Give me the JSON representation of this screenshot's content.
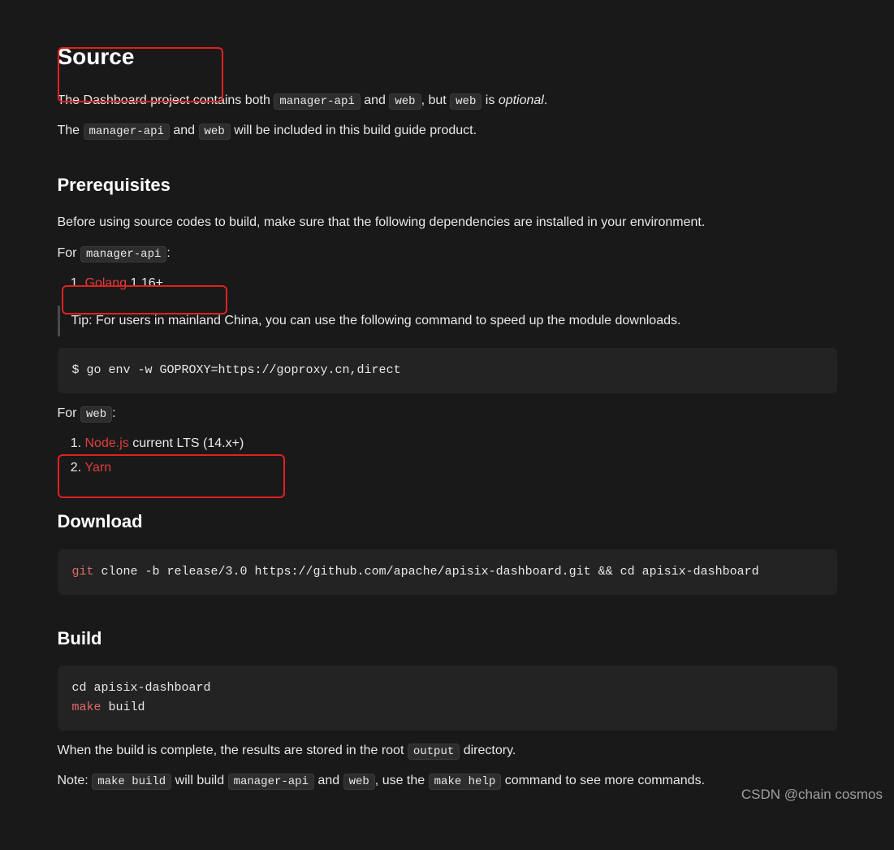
{
  "source": {
    "heading": "Source",
    "p1a": "The Dashboard project contains both ",
    "code1": "manager-api",
    "p1b": " and ",
    "code2": "web",
    "p1c": ", but ",
    "code3": "web",
    "p1d": " is ",
    "ital": "optional",
    "p1e": ".",
    "p2a": "The ",
    "code4": "manager-api",
    "p2b": " and ",
    "code5": "web",
    "p2c": " will be included in this build guide product."
  },
  "prereq": {
    "heading": "Prerequisites",
    "intro": "Before using source codes to build, make sure that the following dependencies are installed in your environment.",
    "for1a": "For ",
    "for1code": "manager-api",
    "for1b": ":",
    "li1_link": "Golang",
    "li1_rest": " 1.16+",
    "tip": "Tip: For users in mainland China, you can use the following command to speed up the module downloads.",
    "cmd1": "$ go env -w GOPROXY=https://goproxy.cn,direct",
    "for2a": "For ",
    "for2code": "web",
    "for2b": ":",
    "li2_link": "Node.js",
    "li2_rest": " current LTS (14.x+)",
    "li3_link": "Yarn"
  },
  "download": {
    "heading": "Download",
    "cmd_kw": "git",
    "cmd_rest": " clone -b release/3.0 https://github.com/apache/apisix-dashboard.git && cd apisix-dashboard"
  },
  "build": {
    "heading": "Build",
    "cmd_line1": "cd apisix-dashboard",
    "cmd_kw": "make",
    "cmd_rest": " build",
    "p1a": "When the build is complete, the results are stored in the root ",
    "p1code": "output",
    "p1b": " directory.",
    "p2a": "Note: ",
    "p2code1": "make build",
    "p2b": " will build ",
    "p2code2": "manager-api",
    "p2c": " and ",
    "p2code3": "web",
    "p2d": ", use the ",
    "p2code4": "make help",
    "p2e": " command to see more commands."
  },
  "watermark": "CSDN @chain cosmos"
}
